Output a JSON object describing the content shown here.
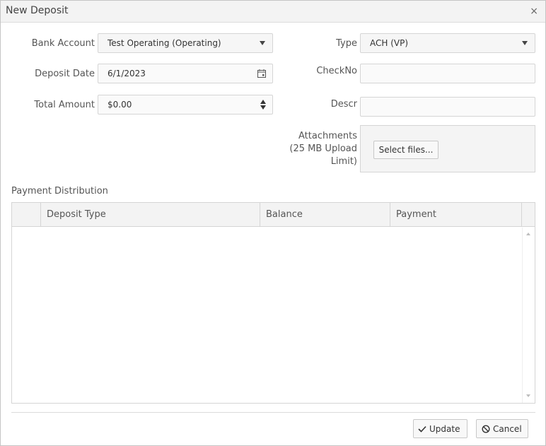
{
  "dialog": {
    "title": "New Deposit",
    "close_glyph": "×"
  },
  "form": {
    "bank_account": {
      "label": "Bank Account",
      "value": "Test Operating (Operating)"
    },
    "deposit_date": {
      "label": "Deposit Date",
      "value": "6/1/2023"
    },
    "total_amount": {
      "label": "Total Amount",
      "value": "$0.00"
    },
    "type": {
      "label": "Type",
      "value": "ACH (VP)"
    },
    "check_no": {
      "label": "CheckNo",
      "value": ""
    },
    "descr": {
      "label": "Descr",
      "value": ""
    },
    "attachments": {
      "label_line1": "Attachments",
      "label_line2": "(25 MB Upload",
      "label_line3": "Limit)",
      "select_files_label": "Select files..."
    }
  },
  "distribution": {
    "title": "Payment Distribution",
    "columns": [
      "Deposit Type",
      "Balance",
      "Payment"
    ],
    "rows": []
  },
  "footer": {
    "update_label": "Update",
    "cancel_label": "Cancel"
  },
  "icons": {
    "calendar": "calendar-icon",
    "check": "check-icon",
    "cancel": "ban-icon"
  }
}
